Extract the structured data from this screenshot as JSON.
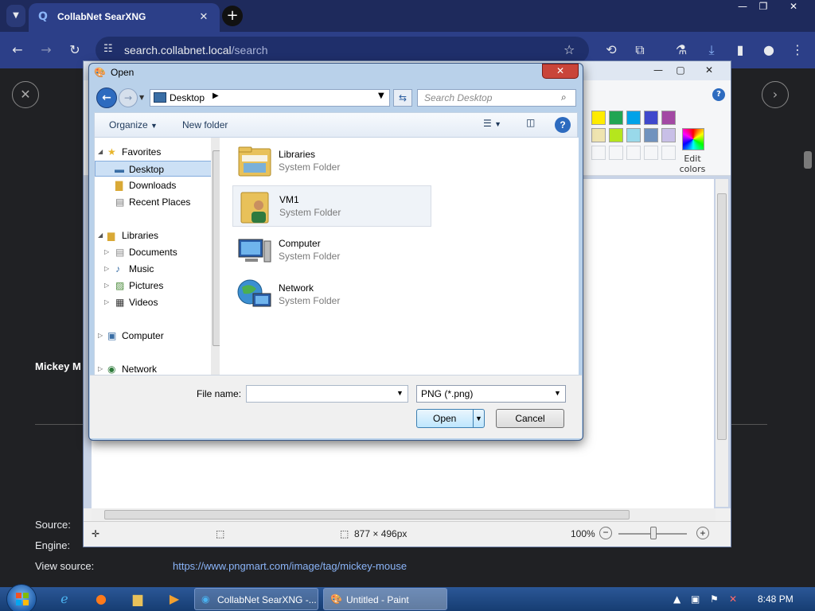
{
  "browser": {
    "tab_title": "CollabNet SearXNG",
    "url_host": "search.collabnet.local",
    "url_path": "/search"
  },
  "page": {
    "result_title_partial": "Mickey M",
    "meta": [
      {
        "label": "Source:",
        "value": ""
      },
      {
        "label": "Engine:",
        "value": ""
      },
      {
        "label": "View source:",
        "value": "https://www.pngmart.com/image/tag/mickey-mouse"
      }
    ]
  },
  "paint": {
    "edit_colors_label": "Edit\ncolors",
    "canvas_size": "877 × 496px",
    "zoom": "100%",
    "palette": [
      "#ffec00",
      "#21a553",
      "#00a2e8",
      "#3f48cc",
      "#a349a4",
      "#efe4b0",
      "#b5e61d",
      "#99d9ea",
      "#7092be",
      "#c8bfe7"
    ]
  },
  "dialog": {
    "title": "Open",
    "address": "Desktop",
    "search_placeholder": "Search Desktop",
    "organize_label": "Organize",
    "new_folder_label": "New folder",
    "nav": {
      "favorites": "Favorites",
      "desktop": "Desktop",
      "downloads": "Downloads",
      "recent_places": "Recent Places",
      "libraries": "Libraries",
      "documents": "Documents",
      "music": "Music",
      "pictures": "Pictures",
      "videos": "Videos",
      "computer": "Computer",
      "network": "Network"
    },
    "items": [
      {
        "name": "Libraries",
        "type": "System Folder"
      },
      {
        "name": "VM1",
        "type": "System Folder"
      },
      {
        "name": "Computer",
        "type": "System Folder"
      },
      {
        "name": "Network",
        "type": "System Folder"
      }
    ],
    "file_name_label": "File name:",
    "file_name_value": "",
    "file_type": "PNG (*.png)",
    "open_label": "Open",
    "cancel_label": "Cancel"
  },
  "taskbar": {
    "tasks": [
      {
        "label": "CollabNet SearXNG -..."
      },
      {
        "label": "Untitled - Paint"
      }
    ],
    "clock": "8:48 PM"
  }
}
